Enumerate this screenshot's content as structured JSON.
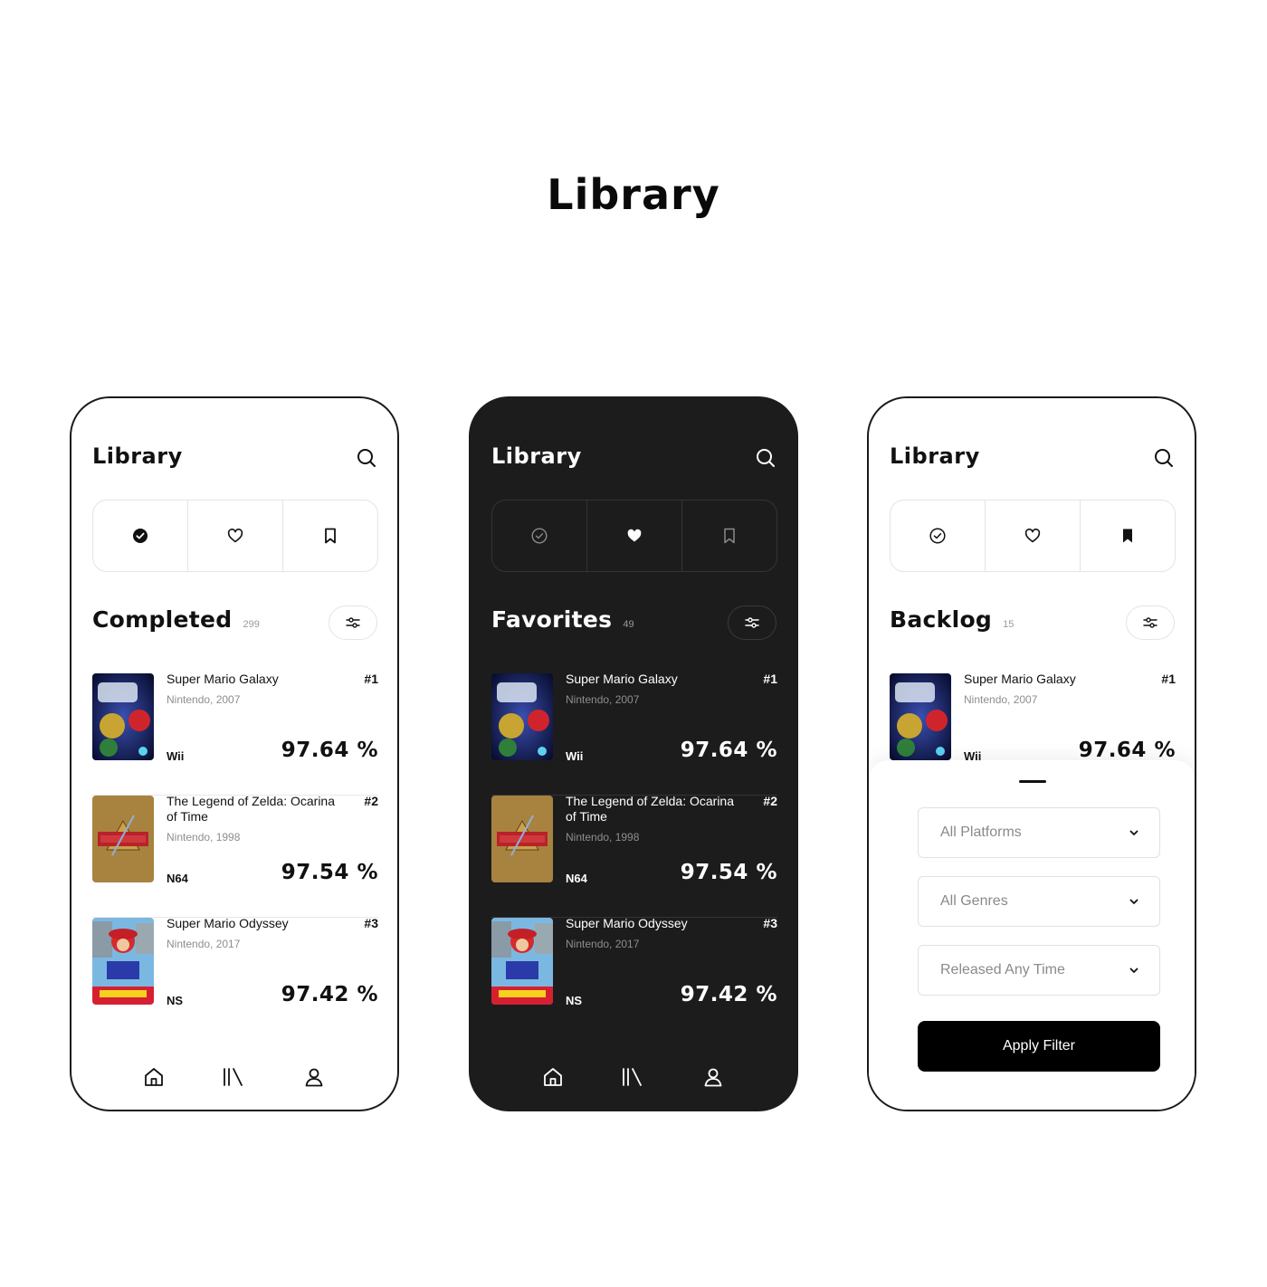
{
  "page_title": "Library",
  "games": [
    {
      "title": "Super Mario Galaxy",
      "meta": "Nintendo, 2007",
      "rank": "#1",
      "platform": "Wii",
      "score": "97.64 %"
    },
    {
      "title": "The Legend of Zelda: Ocarina of Time",
      "meta": "Nintendo, 1998",
      "rank": "#2",
      "platform": "N64",
      "score": "97.54 %"
    },
    {
      "title": "Super Mario Odyssey",
      "meta": "Nintendo, 2017",
      "rank": "#3",
      "platform": "NS",
      "score": "97.42 %"
    }
  ],
  "screens": [
    {
      "app_title": "Library",
      "section": "Completed",
      "count": "299",
      "theme": "light",
      "active_tab": "completed"
    },
    {
      "app_title": "Library",
      "section": "Favorites",
      "count": "49",
      "theme": "dark",
      "active_tab": "favorites"
    },
    {
      "app_title": "Library",
      "section": "Backlog",
      "count": "15",
      "theme": "light",
      "active_tab": "backlog"
    }
  ],
  "filter_sheet": {
    "platforms": "All Platforms",
    "genres": "All Genres",
    "released": "Released Any Time",
    "apply_label": "Apply Filter"
  },
  "icons": {
    "tabs": [
      "check-circle-icon",
      "heart-icon",
      "bookmark-icon"
    ],
    "nav": [
      "home-icon",
      "library-icon",
      "user-icon"
    ],
    "header": "search-icon",
    "filter": "sliders-icon"
  },
  "colors": {
    "dark_bg": "#1c1c1c",
    "light_bg": "#ffffff",
    "accent": "#000000"
  }
}
